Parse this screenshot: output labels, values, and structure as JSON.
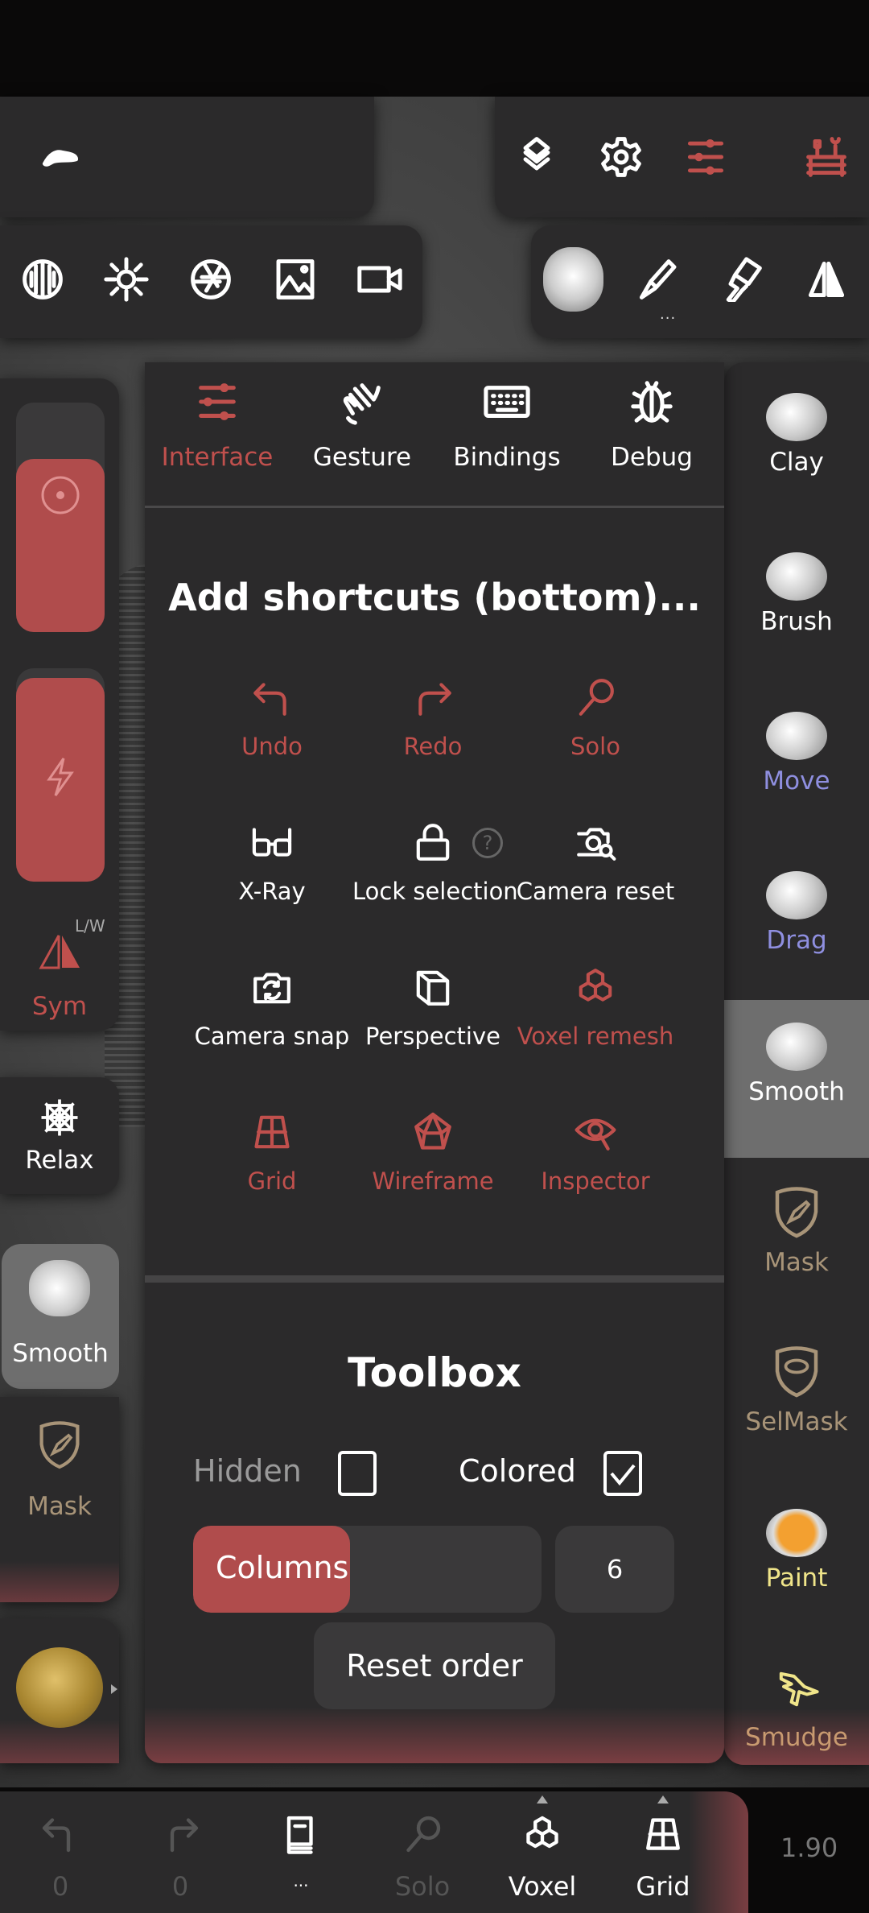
{
  "colors": {
    "accent": "#c0504d",
    "panel": "#2b2a2b",
    "selected": "#6e6e6e",
    "move_drag": "#8f8fe0",
    "mask": "#a89478",
    "paint": "#f0e58a"
  },
  "top_toolbar": {
    "row1_left": [
      "logo-icon",
      "folder-icon",
      "share-icon",
      "gold-bars-icon"
    ],
    "row1_right": [
      "layers-icon",
      "gear-icon",
      "sliders-icon",
      "toolbox-icon"
    ],
    "row2_left": [
      "matcap-grid-icon",
      "sun-icon",
      "aperture-icon",
      "image-icon",
      "video-camera-icon"
    ],
    "row2_right": [
      "smooth-brush-icon",
      "paintbrush-icon",
      "fill-brush-icon",
      "symmetry-icon"
    ],
    "more": "..."
  },
  "left_panel": {
    "sym_label": "Sym",
    "sym_mode": "L/W",
    "slider1_icon": "target-icon",
    "slider2_icon": "lightning-icon",
    "tools": [
      {
        "label": "Relax"
      },
      {
        "label": "Smooth"
      },
      {
        "label": "Mask"
      }
    ]
  },
  "settings": {
    "tabs": [
      {
        "label": "Interface",
        "active": true
      },
      {
        "label": "Gesture"
      },
      {
        "label": "Bindings"
      },
      {
        "label": "Debug"
      }
    ],
    "shortcuts_title": "Add shortcuts (bottom)...",
    "shortcuts": [
      {
        "label": "Undo",
        "on": true
      },
      {
        "label": "Redo",
        "on": true
      },
      {
        "label": "Solo",
        "on": true
      },
      {
        "label": "X-Ray",
        "on": false
      },
      {
        "label": "Lock selection",
        "on": false
      },
      {
        "label": "Camera reset",
        "on": false
      },
      {
        "label": "Camera snap",
        "on": false
      },
      {
        "label": "Perspective",
        "on": false
      },
      {
        "label": "Voxel remesh",
        "on": true
      },
      {
        "label": "Grid",
        "on": true
      },
      {
        "label": "Wireframe",
        "on": true
      },
      {
        "label": "Inspector",
        "on": true
      }
    ],
    "help": "?",
    "toolbox_title": "Toolbox",
    "hidden_label": "Hidden",
    "hidden_checked": false,
    "colored_label": "Colored",
    "colored_checked": true,
    "columns_label": "Columns",
    "columns_value": "6",
    "columns_fill_pct": 45,
    "reset_label": "Reset order"
  },
  "right_tools": [
    {
      "label": "Clay"
    },
    {
      "label": "Brush"
    },
    {
      "label": "Move"
    },
    {
      "label": "Drag"
    },
    {
      "label": "Smooth",
      "selected": true
    },
    {
      "label": "Mask"
    },
    {
      "label": "SelMask"
    },
    {
      "label": "Paint"
    },
    {
      "label": "Smudge"
    }
  ],
  "bottom_bar": {
    "items": [
      {
        "label": "0"
      },
      {
        "label": "0"
      },
      {
        "label": "..."
      },
      {
        "label": "Solo"
      },
      {
        "label": "Voxel"
      },
      {
        "label": "Grid"
      }
    ],
    "zoom": "1.90"
  }
}
